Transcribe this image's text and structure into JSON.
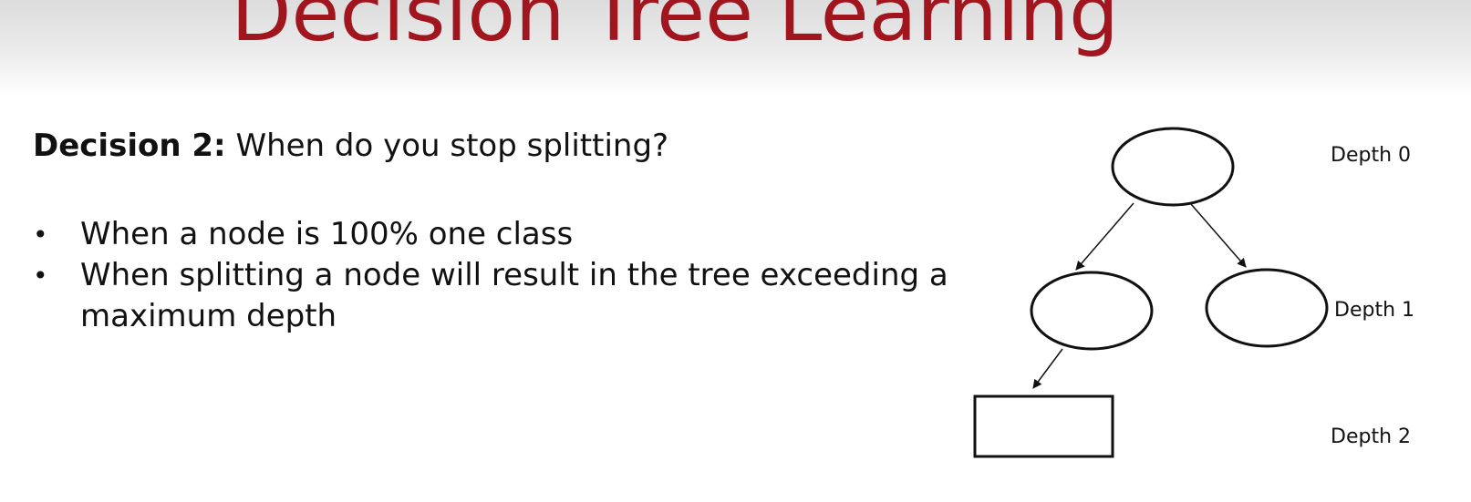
{
  "slide": {
    "title": "Decision Tree Learning",
    "decision_label": "Decision 2:",
    "decision_question": "When do you stop splitting?",
    "bullets": [
      "When a node is 100% one class",
      "When splitting a node will result in the tree exceeding a maximum depth"
    ]
  },
  "diagram": {
    "depth_labels": [
      "Depth 0",
      "Depth 1",
      "Depth 2"
    ]
  }
}
